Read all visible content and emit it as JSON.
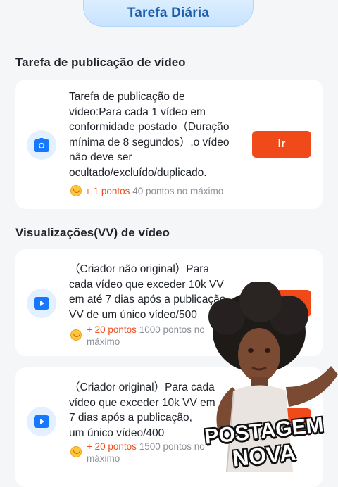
{
  "header": {
    "title": "Tarefa Diária"
  },
  "sections": [
    {
      "title": "Tarefa de publicação de vídeo",
      "task": {
        "icon": "camera-icon",
        "description_lines": [
          "Tarefa de publicação de",
          "vídeo:Para cada 1 vídeo em",
          "conformidade postado（Duração",
          "mínima de 8 segundos）,o vídeo",
          "não deve ser",
          "ocultado/excluído/duplicado."
        ],
        "button_label": "Ir",
        "reward_points": "+ 1 pontos",
        "reward_max": "40 pontos no máximo"
      }
    },
    {
      "title": "Visualizações(VV) de vídeo",
      "tasks": [
        {
          "icon": "play-icon",
          "description_lines": [
            "（Criador não original）Para",
            "cada vídeo que exceder 10k VV",
            "em até 7 dias após a publicação,",
            "VV de um único vídeo/500"
          ],
          "button_label": "Ir",
          "reward_points": "+ 20 pontos",
          "reward_max_line1": "1000 pontos no",
          "reward_max_line2": "máximo"
        },
        {
          "icon": "play-icon",
          "description_lines": [
            "（Criador original）Para cada",
            "vídeo que exceder 10k VV em",
            "7 dias após a publicação,",
            "um único vídeo/400"
          ],
          "button_label": "Ir",
          "reward_points": "+ 20 pontos",
          "reward_max_line1": "1500 pontos no",
          "reward_max_line2": "máximo"
        }
      ]
    }
  ],
  "overlay": {
    "sticker_text_line1": "POSTAGEM",
    "sticker_text_line2": "NOVA"
  },
  "colors": {
    "accent": "#f04a1a",
    "header_text": "#1d5fa8",
    "icon_blue": "#1677ff"
  }
}
